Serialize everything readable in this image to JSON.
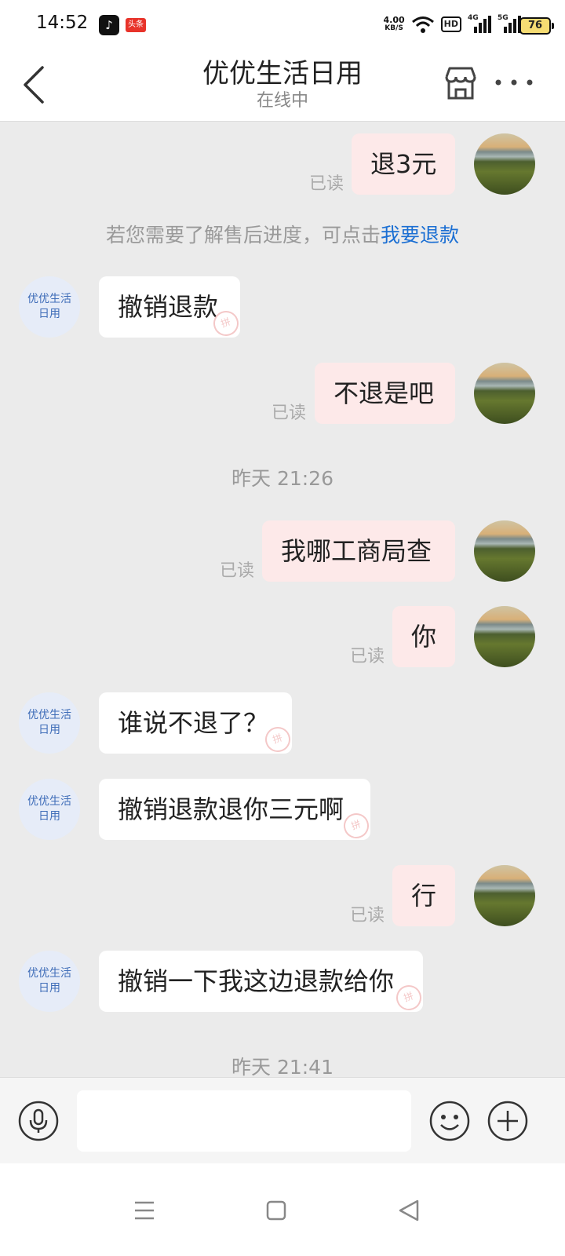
{
  "status_bar": {
    "time": "14:52",
    "app_icons": [
      "tiktok-icon",
      "toutiao-icon"
    ],
    "toutiao_label": "头条",
    "speed_value": "4.00",
    "speed_unit": "KB/S",
    "hd_label": "HD",
    "net1": "4G",
    "net2": "5G",
    "battery": "76",
    "battery_color": "#f5dc73"
  },
  "header": {
    "title": "优优生活日用",
    "subtitle": "在线中",
    "icons": [
      "back-icon",
      "shop-icon",
      "more-icon"
    ]
  },
  "shop_avatar": {
    "line1": "优优生活",
    "line2": "日用",
    "color": "#3f6db8"
  },
  "read_label": "已读",
  "messages": [
    {
      "from": "me",
      "text": "退3元",
      "read": "已读"
    },
    {
      "from": "system",
      "text": "若您需要了解售后进度，可点击",
      "link": "我要退款"
    },
    {
      "from": "shop",
      "text": "撤销退款"
    },
    {
      "from": "me",
      "text": "不退是吧",
      "read": "已读"
    },
    {
      "from": "time",
      "text": "昨天 21:26"
    },
    {
      "from": "me",
      "text": "我哪工商局查",
      "read": "已读"
    },
    {
      "from": "me",
      "text": "你",
      "read": "已读"
    },
    {
      "from": "shop",
      "text": "谁说不退了？"
    },
    {
      "from": "shop",
      "text": "撤销退款退你三元啊"
    },
    {
      "from": "me",
      "text": "行",
      "read": "已读"
    },
    {
      "from": "shop",
      "text": "撤销一下我这边退款给你"
    },
    {
      "from": "time",
      "text": "昨天 21:41"
    }
  ],
  "input_bar": {
    "placeholder": "",
    "icons": [
      "voice-icon",
      "emoji-icon",
      "plus-icon"
    ]
  },
  "nav_bar": {
    "icons": [
      "menu-icon",
      "home-icon",
      "back-triangle-icon"
    ]
  },
  "colors": {
    "my_bubble": "#fde9e9",
    "shop_bubble": "#ffffff",
    "link": "#1b6fd3",
    "background": "#ebebeb"
  }
}
